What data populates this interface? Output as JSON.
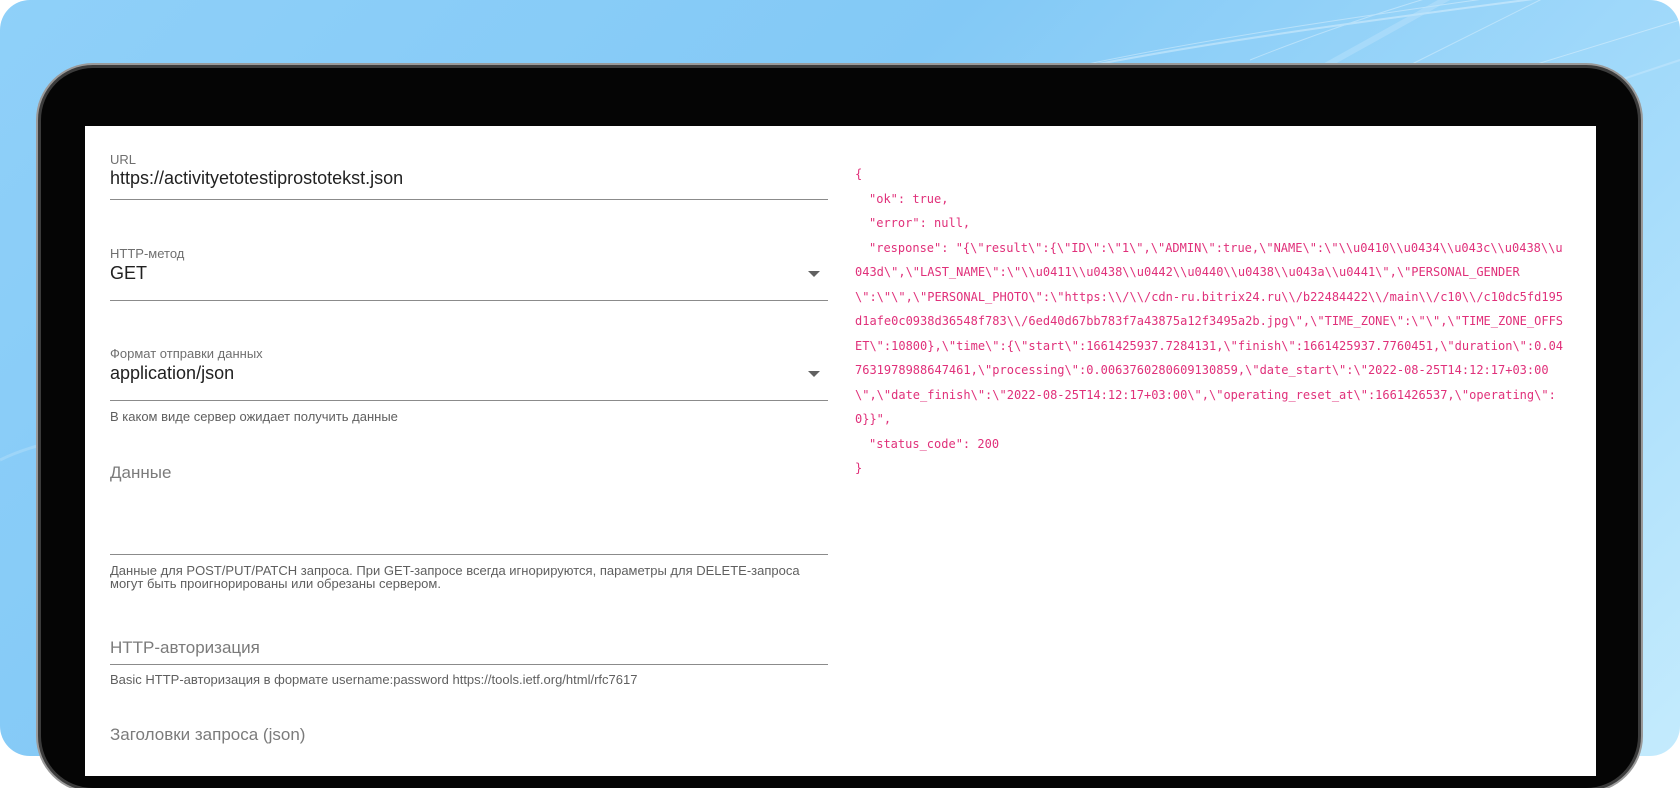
{
  "form": {
    "url": {
      "label": "URL",
      "value": "https://activityetotestiprostotekst.json"
    },
    "http_method": {
      "label": "HTTP-метод",
      "value": "GET"
    },
    "data_format": {
      "label": "Формат отправки данных",
      "value": "application/json",
      "helper": "В каком виде сервер ожидает получить данные"
    },
    "data": {
      "placeholder": "Данные",
      "helper": "Данные для POST/PUT/PATCH запроса. При GET-запросе всегда игнорируются, параметры для DELETE-запроса могут быть проигнорированы или обрезаны сервером."
    },
    "http_auth": {
      "placeholder": "HTTP-авторизация",
      "helper": "Basic HTTP-авторизация в формате username:password https://tools.ietf.org/html/rfc7617"
    },
    "headers": {
      "placeholder": "Заголовки запроса (json)"
    }
  },
  "response_json": {
    "open_brace": "{",
    "ok_line": "\"ok\": true,",
    "error_line": "\"error\": null,",
    "response_line": "\"response\": \"{\\\"result\\\":{\\\"ID\\\":\\\"1\\\",\\\"ADMIN\\\":true,\\\"NAME\\\":\\\"\\\\u0410\\\\u0434\\\\u043c\\\\u0438\\\\u043d\\\",\\\"LAST_NAME\\\":\\\"\\\\u0411\\\\u0438\\\\u0442\\\\u0440\\\\u0438\\\\u043a\\\\u0441\\\",\\\"PERSONAL_GENDER\\\":\\\"\\\",\\\"PERSONAL_PHOTO\\\":\\\"https:\\\\/\\\\/cdn-ru.bitrix24.ru\\\\/b22484422\\\\/main\\\\/c10\\\\/c10dc5fd195d1afe0c0938d36548f783\\\\/6ed40d67bb783f7a43875a12f3495a2b.jpg\\\",\\\"TIME_ZONE\\\":\\\"\\\",\\\"TIME_ZONE_OFFSET\\\":10800},\\\"time\\\":{\\\"start\\\":1661425937.7284131,\\\"finish\\\":1661425937.7760451,\\\"duration\\\":0.047631978988647461,\\\"processing\\\":0.0063760280609130859,\\\"date_start\\\":\\\"2022-08-25T14:12:17+03:00\\\",\\\"date_finish\\\":\\\"2022-08-25T14:12:17+03:00\\\",\\\"operating_reset_at\\\":1661426537,\\\"operating\\\":0}}\",",
    "status_line": "\"status_code\": 200",
    "close_brace": "}"
  },
  "colors": {
    "json_text": "#e0307a",
    "background_gradient": "#8fd0f9"
  }
}
